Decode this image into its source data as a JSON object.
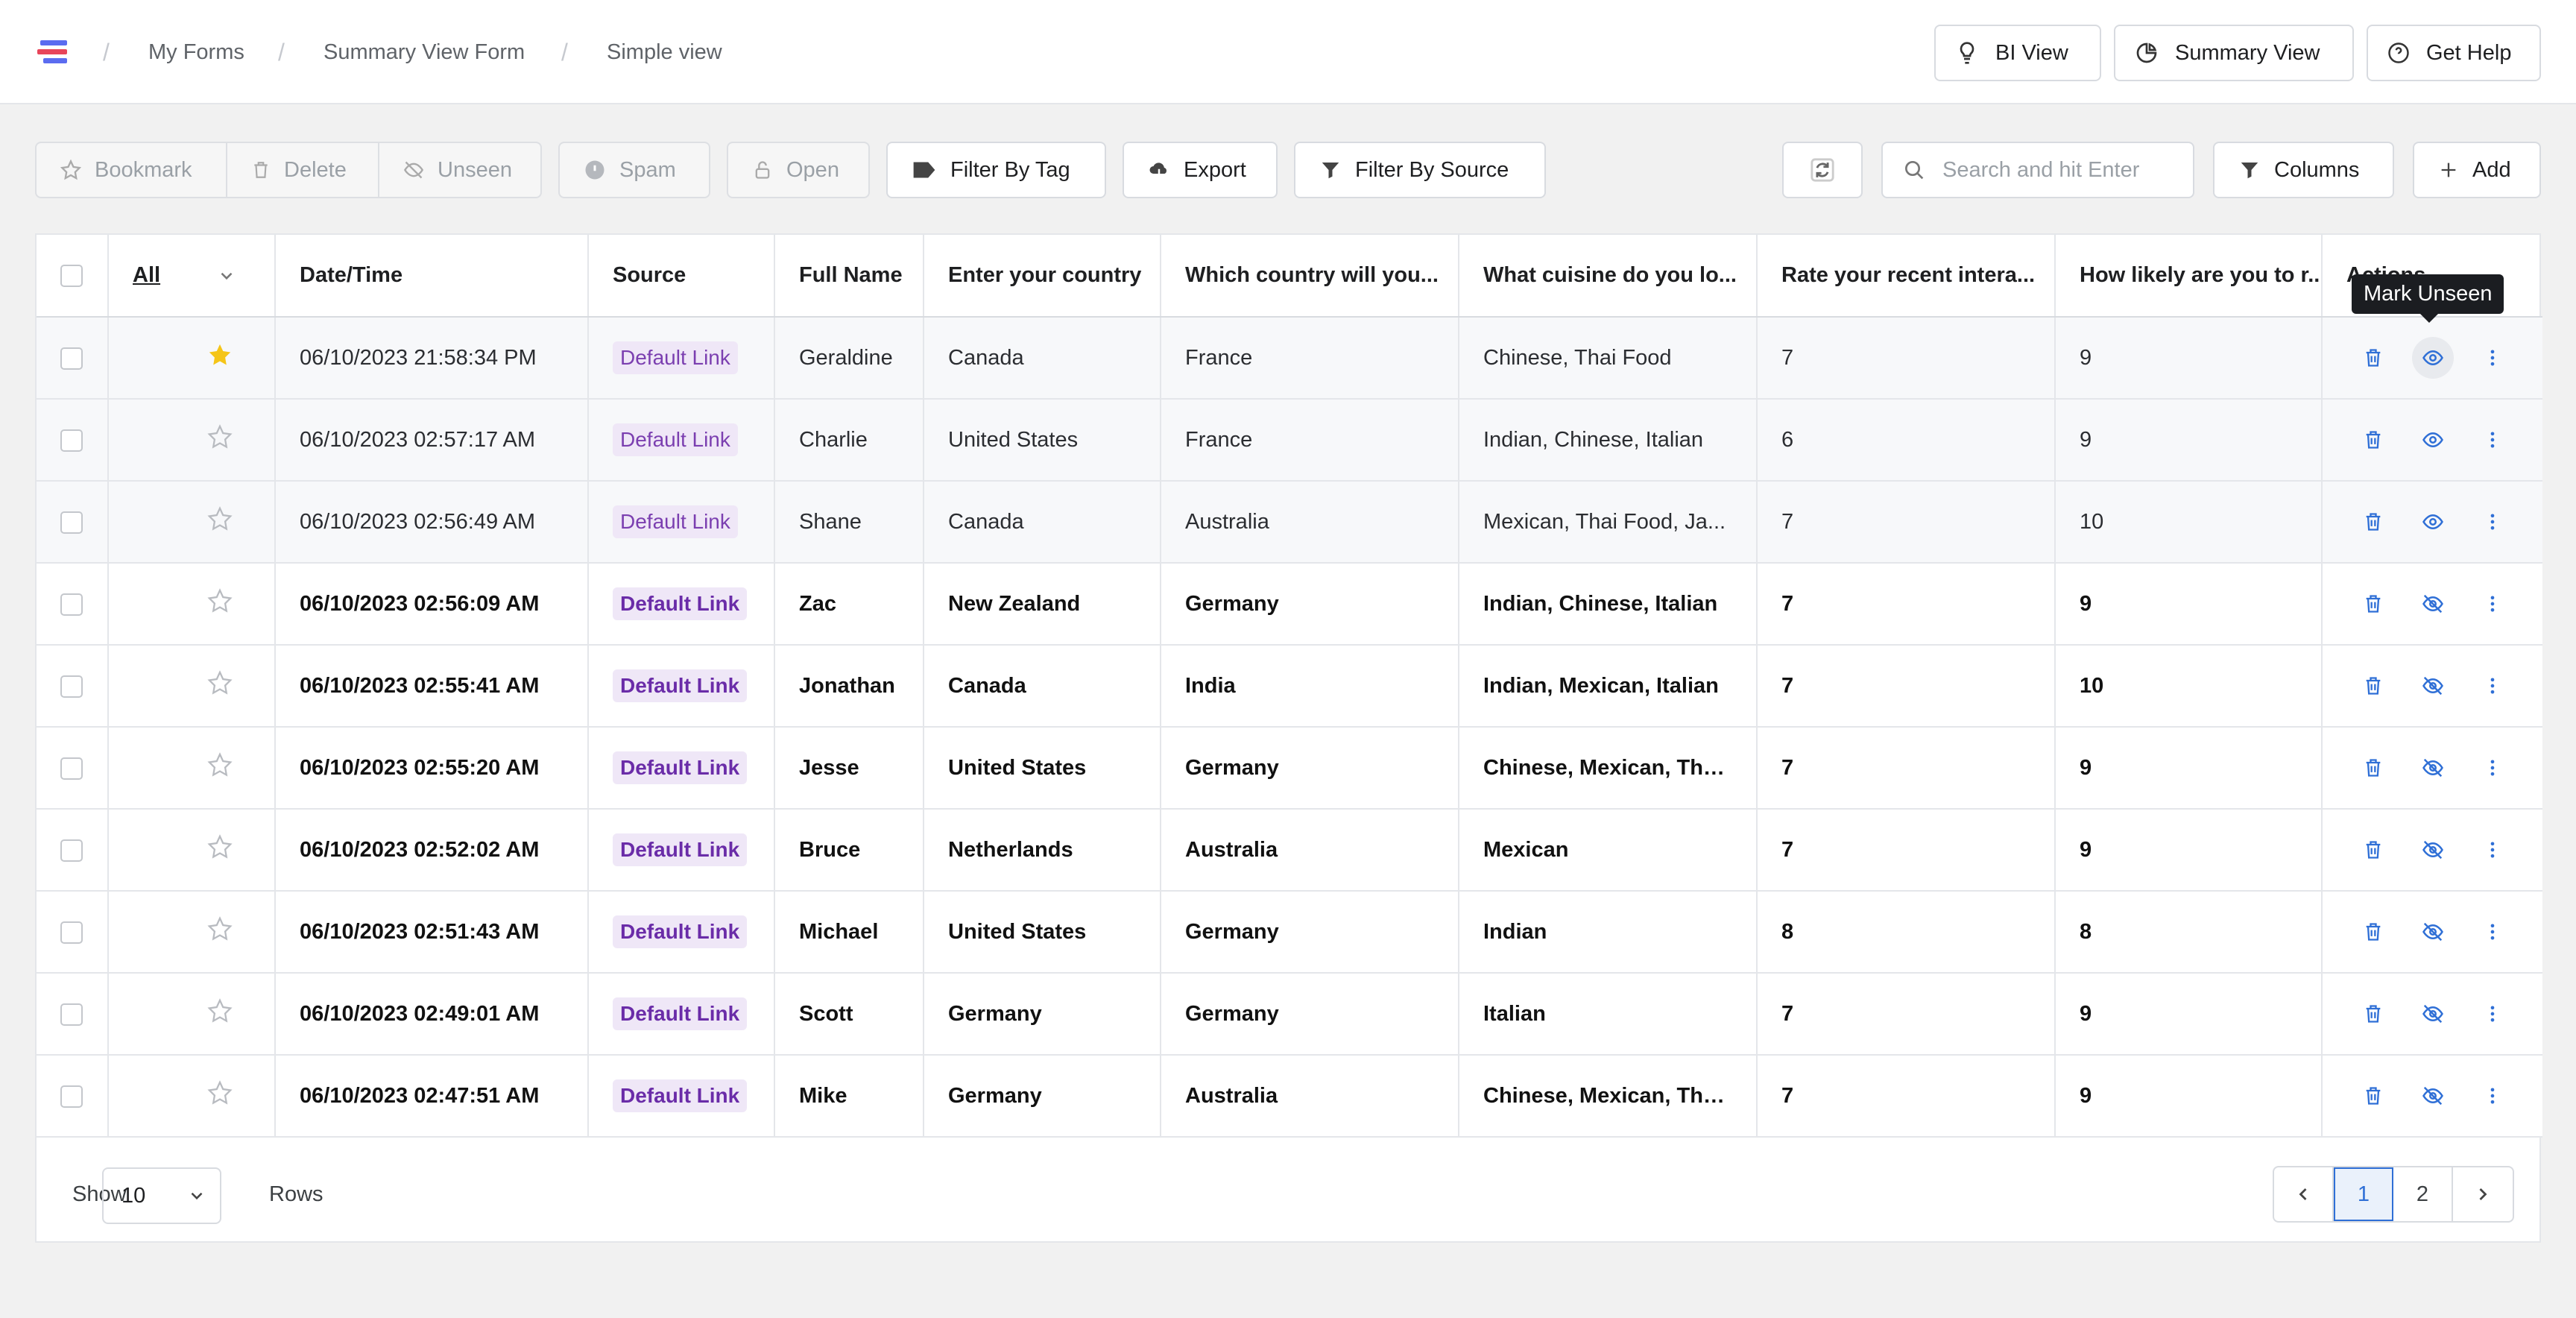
{
  "breadcrumbs": [
    "My Forms",
    "Summary View Form",
    "Simple view"
  ],
  "top_buttons": {
    "bi_view": "BI View",
    "summary_view": "Summary View",
    "get_help": "Get Help"
  },
  "toolbar": {
    "bookmark": "Bookmark",
    "delete": "Delete",
    "unseen": "Unseen",
    "spam": "Spam",
    "open": "Open",
    "filter_tag": "Filter By Tag",
    "export": "Export",
    "filter_source": "Filter By Source",
    "search_placeholder": "Search and hit Enter",
    "columns": "Columns",
    "add": "Add"
  },
  "table": {
    "headers": {
      "all": "All",
      "datetime": "Date/Time",
      "source": "Source",
      "name": "Full Name",
      "country": "Enter your country",
      "visit": "Which country will you...",
      "cuisine": "What cuisine do you lo...",
      "rate": "Rate your recent intera...",
      "likely": "How likely are you to r...",
      "actions": "Actions"
    },
    "rows": [
      {
        "starred": true,
        "seen": true,
        "datetime": "06/10/2023 21:58:34 PM",
        "source": "Default Link",
        "name": "Geraldine",
        "country": "Canada",
        "visit": "France",
        "cuisine": "Chinese, Thai Food",
        "rate": "7",
        "likely": "9"
      },
      {
        "starred": false,
        "seen": true,
        "datetime": "06/10/2023 02:57:17 AM",
        "source": "Default Link",
        "name": "Charlie",
        "country": "United States",
        "visit": "France",
        "cuisine": "Indian, Chinese, Italian",
        "rate": "6",
        "likely": "9"
      },
      {
        "starred": false,
        "seen": true,
        "datetime": "06/10/2023 02:56:49 AM",
        "source": "Default Link",
        "name": "Shane",
        "country": "Canada",
        "visit": "Australia",
        "cuisine": "Mexican, Thai Food, Ja...",
        "rate": "7",
        "likely": "10"
      },
      {
        "starred": false,
        "seen": false,
        "datetime": "06/10/2023 02:56:09 AM",
        "source": "Default Link",
        "name": "Zac",
        "country": "New Zealand",
        "visit": "Germany",
        "cuisine": "Indian, Chinese, Italian",
        "rate": "7",
        "likely": "9"
      },
      {
        "starred": false,
        "seen": false,
        "datetime": "06/10/2023 02:55:41 AM",
        "source": "Default Link",
        "name": "Jonathan",
        "country": "Canada",
        "visit": "India",
        "cuisine": "Indian, Mexican, Italian",
        "rate": "7",
        "likely": "10"
      },
      {
        "starred": false,
        "seen": false,
        "datetime": "06/10/2023 02:55:20 AM",
        "source": "Default Link",
        "name": "Jesse",
        "country": "United States",
        "visit": "Germany",
        "cuisine": "Chinese, Mexican, Tha...",
        "rate": "7",
        "likely": "9"
      },
      {
        "starred": false,
        "seen": false,
        "datetime": "06/10/2023 02:52:02 AM",
        "source": "Default Link",
        "name": "Bruce",
        "country": "Netherlands",
        "visit": "Australia",
        "cuisine": "Mexican",
        "rate": "7",
        "likely": "9"
      },
      {
        "starred": false,
        "seen": false,
        "datetime": "06/10/2023 02:51:43 AM",
        "source": "Default Link",
        "name": "Michael",
        "country": "United States",
        "visit": "Germany",
        "cuisine": "Indian",
        "rate": "8",
        "likely": "8"
      },
      {
        "starred": false,
        "seen": false,
        "datetime": "06/10/2023 02:49:01 AM",
        "source": "Default Link",
        "name": "Scott",
        "country": "Germany",
        "visit": "Germany",
        "cuisine": "Italian",
        "rate": "7",
        "likely": "9"
      },
      {
        "starred": false,
        "seen": false,
        "datetime": "06/10/2023 02:47:51 AM",
        "source": "Default Link",
        "name": "Mike",
        "country": "Germany",
        "visit": "Australia",
        "cuisine": "Chinese, Mexican, Tha...",
        "rate": "7",
        "likely": "9"
      }
    ]
  },
  "tooltip": "Mark Unseen",
  "footer": {
    "show": "Show",
    "rows_value": "10",
    "rows": "Rows",
    "pages": [
      "1",
      "2"
    ],
    "current_page": "1"
  },
  "colors": {
    "accent": "#2f6fd6",
    "star": "#f5c518",
    "badge_bg": "#efe7f7",
    "badge_text": "#7b3fb0"
  }
}
